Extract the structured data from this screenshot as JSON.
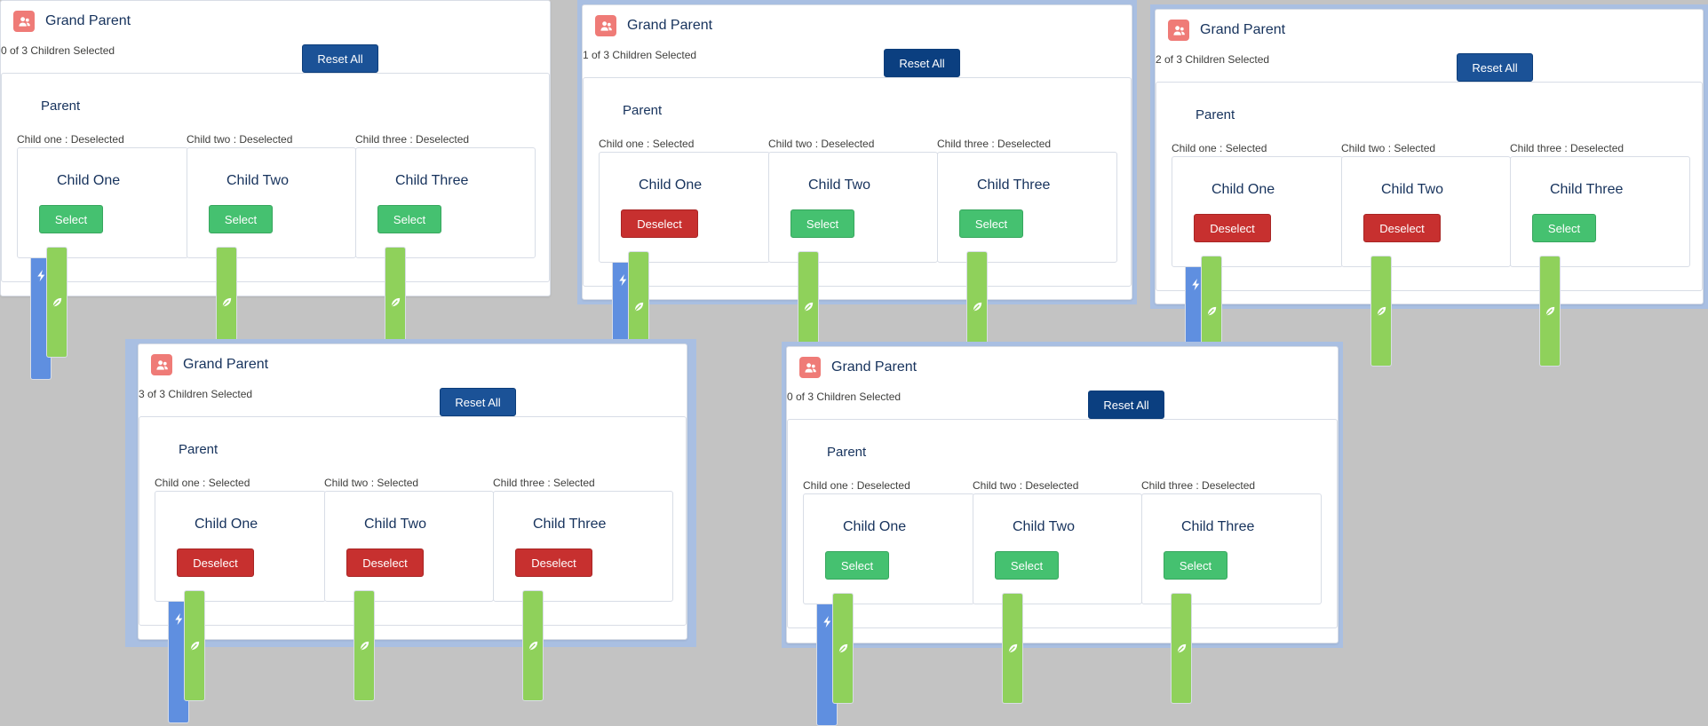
{
  "grand_parent_title": "Grand Parent",
  "parent_title": "Parent",
  "reset_label": "Reset All",
  "colors": {
    "background": "#c3c3c3",
    "highlight_border": "#a9bfe2",
    "reset_button": "#1b5297",
    "select_button": "#45c170",
    "deselect_button": "#c7302f",
    "grand_parent_icon": "#ef7b77",
    "parent_icon": "#5f8fe0",
    "child_icon": "#8fd15b"
  },
  "icons": {
    "grand_parent": "people-icon",
    "parent": "lightning-icon",
    "child": "leaf-icon"
  },
  "panels": [
    {
      "count_text": "0 of 3 Children Selected",
      "children": [
        {
          "name": "Child One",
          "status_label": "Child one : Deselected",
          "button_label": "Select",
          "selected": false
        },
        {
          "name": "Child Two",
          "status_label": "Child two : Deselected",
          "button_label": "Select",
          "selected": false
        },
        {
          "name": "Child Three",
          "status_label": "Child three : Deselected",
          "button_label": "Select",
          "selected": false
        }
      ]
    },
    {
      "count_text": "1 of 3 Children Selected",
      "children": [
        {
          "name": "Child One",
          "status_label": "Child one : Selected",
          "button_label": "Deselect",
          "selected": true
        },
        {
          "name": "Child Two",
          "status_label": "Child two : Deselected",
          "button_label": "Select",
          "selected": false
        },
        {
          "name": "Child Three",
          "status_label": "Child three : Deselected",
          "button_label": "Select",
          "selected": false
        }
      ]
    },
    {
      "count_text": "2 of 3 Children Selected",
      "children": [
        {
          "name": "Child One",
          "status_label": "Child one : Selected",
          "button_label": "Deselect",
          "selected": true
        },
        {
          "name": "Child Two",
          "status_label": "Child two : Selected",
          "button_label": "Deselect",
          "selected": true
        },
        {
          "name": "Child Three",
          "status_label": "Child three : Deselected",
          "button_label": "Select",
          "selected": false
        }
      ]
    },
    {
      "count_text": "3 of 3 Children Selected",
      "children": [
        {
          "name": "Child One",
          "status_label": "Child one : Selected",
          "button_label": "Deselect",
          "selected": true
        },
        {
          "name": "Child Two",
          "status_label": "Child two : Selected",
          "button_label": "Deselect",
          "selected": true
        },
        {
          "name": "Child Three",
          "status_label": "Child three : Selected",
          "button_label": "Deselect",
          "selected": true
        }
      ]
    },
    {
      "count_text": "0 of 3 Children Selected",
      "children": [
        {
          "name": "Child One",
          "status_label": "Child one : Deselected",
          "button_label": "Select",
          "selected": false
        },
        {
          "name": "Child Two",
          "status_label": "Child two : Deselected",
          "button_label": "Select",
          "selected": false
        },
        {
          "name": "Child Three",
          "status_label": "Child three : Deselected",
          "button_label": "Select",
          "selected": false
        }
      ]
    }
  ]
}
